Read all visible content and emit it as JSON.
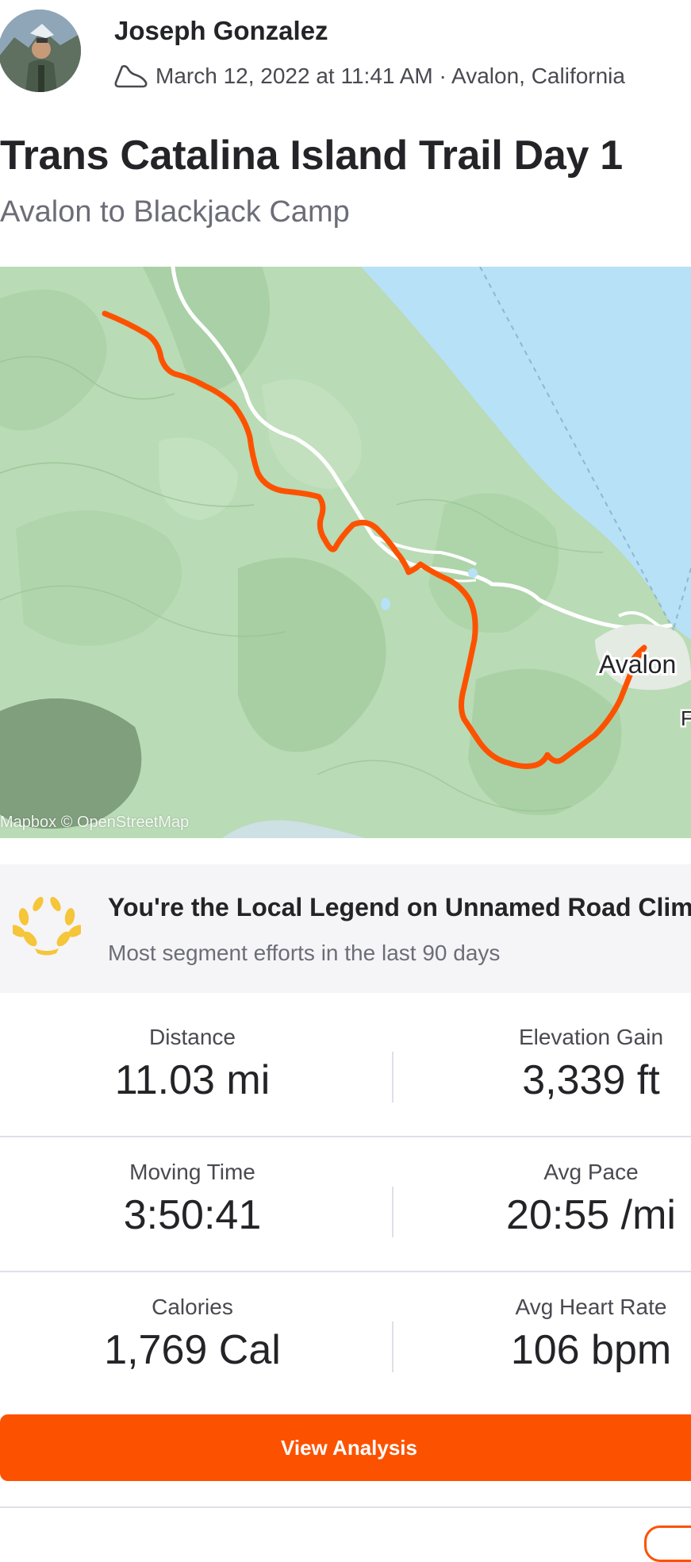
{
  "activity": {
    "athlete_name": "Joseph Gonzalez",
    "sport_icon": "shoe-icon",
    "datetime_location": "March 12, 2022 at 11:41 AM · Avalon, California",
    "title": "Trans Catalina Island Trail Day 1",
    "description": "Avalon to Blackjack Camp"
  },
  "map": {
    "place_label": "Avalon",
    "edge_label": "F",
    "attribution": "Mapbox © OpenStreetMap",
    "route_color": "#fc5200",
    "water_color": "#b7e1f7",
    "land_color": "#b9dbb5"
  },
  "local_legend": {
    "icon": "laurel-icon",
    "title": "You're the Local Legend on Unnamed Road Climb",
    "subtitle": "Most segment efforts in the last 90 days",
    "icon_color": "#f5c53a"
  },
  "stats": [
    {
      "label": "Distance",
      "value": "11.03 mi"
    },
    {
      "label": "Elevation Gain",
      "value": "3,339 ft"
    },
    {
      "label": "Moving Time",
      "value": "3:50:41"
    },
    {
      "label": "Avg Pace",
      "value": "20:55 /mi"
    },
    {
      "label": "Calories",
      "value": "1,769 Cal"
    },
    {
      "label": "Avg Heart Rate",
      "value": "106 bpm"
    }
  ],
  "actions": {
    "view_analysis": "View Analysis",
    "accent_color": "#fc5200"
  }
}
